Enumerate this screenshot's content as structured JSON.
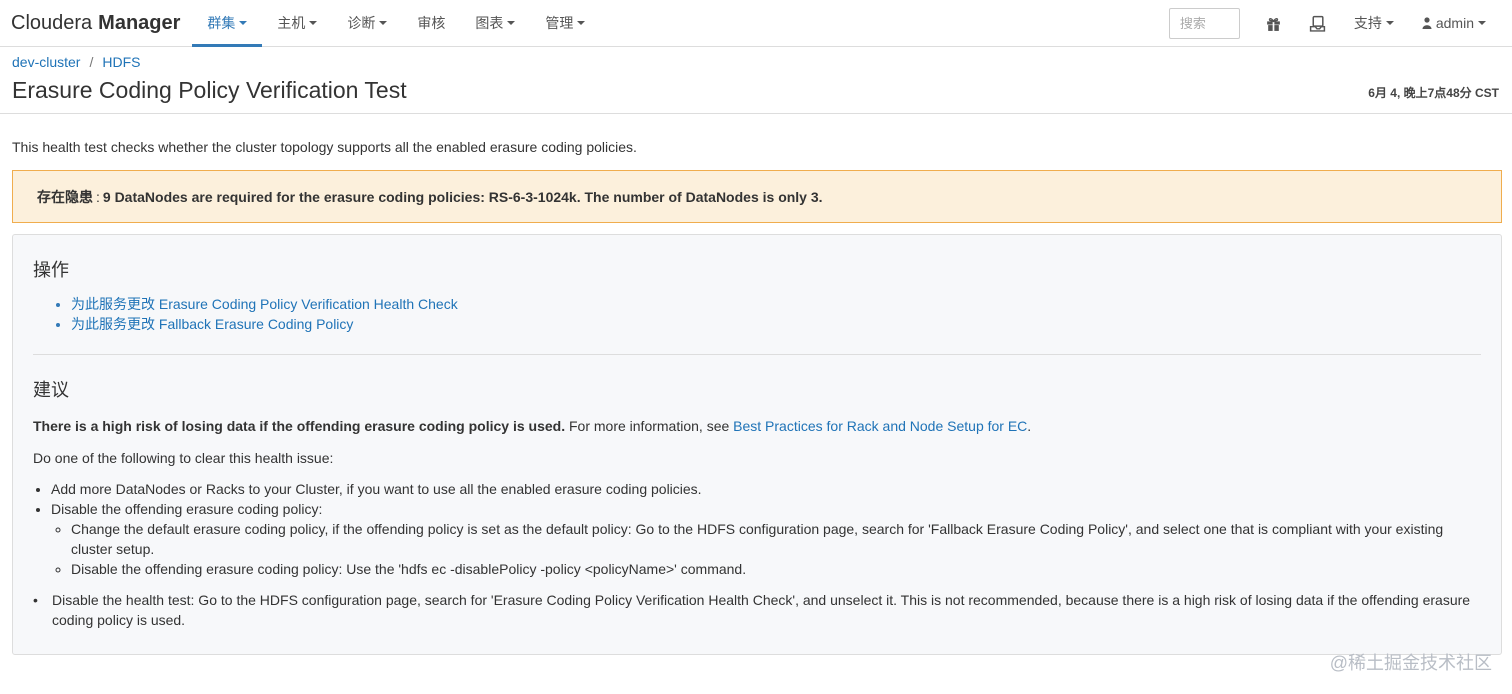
{
  "navbar": {
    "brand_light": "Cloudera",
    "brand_bold": "Manager",
    "menu": [
      {
        "label": "群集",
        "dropdown": true,
        "active": true
      },
      {
        "label": "主机",
        "dropdown": true,
        "active": false
      },
      {
        "label": "诊断",
        "dropdown": true,
        "active": false
      },
      {
        "label": "审核",
        "dropdown": false,
        "active": false
      },
      {
        "label": "图表",
        "dropdown": true,
        "active": false
      },
      {
        "label": "管理",
        "dropdown": true,
        "active": false
      }
    ],
    "search_placeholder": "搜索",
    "icons": [
      "gift-icon",
      "parcel-icon"
    ],
    "support_label": "支持",
    "user_label": "admin"
  },
  "header": {
    "breadcrumb": [
      "dev-cluster",
      "HDFS"
    ],
    "title": "Erasure Coding Policy Verification Test",
    "timestamp": "6月 4, 晚上7点48分 CST"
  },
  "description": "This health test checks whether the cluster topology supports all the enabled erasure coding policies.",
  "alert": {
    "label": "存在隐患",
    "message": "9 DataNodes are required for the erasure coding policies: RS-6-3-1024k. The number of DataNodes is only 3."
  },
  "actions": {
    "heading": "操作",
    "links": [
      "为此服务更改 Erasure Coding Policy Verification Health Check",
      "为此服务更改 Fallback Erasure Coding Policy"
    ]
  },
  "advice": {
    "heading": "建议",
    "lead_bold": "There is a high risk of losing data if the offending erasure coding policy is used.",
    "lead_text": " For more information, see ",
    "lead_link": "Best Practices for Rack and Node Setup for EC",
    "lead_end": ".",
    "steps_intro": "Do one of the following to clear this health issue:",
    "step1": "Add more DataNodes or Racks to your Cluster, if you want to use all the enabled erasure coding policies.",
    "step2": "Disable the offending erasure coding policy:",
    "step2_sub1": "Change the default erasure coding policy, if the offending policy is set as the default policy: Go to the HDFS configuration page, search for 'Fallback Erasure Coding Policy', and select one that is compliant with your existing cluster setup.",
    "step2_sub2": "Disable the offending erasure coding policy: Use the 'hdfs ec -disablePolicy -policy <policyName>' command.",
    "step3": "Disable the health test: Go to the HDFS configuration page, search for 'Erasure Coding Policy Verification Health Check', and unselect it. This is not recommended, because there is a high risk of losing data if the offending erasure coding policy is used."
  },
  "watermark": "@稀土掘金技术社区",
  "colors": {
    "accent": "#337ab7",
    "link": "#1f73b7",
    "alert_bg": "#fcf0dc",
    "alert_border": "#f0ad4e",
    "panel_bg": "#f7f8fa"
  }
}
